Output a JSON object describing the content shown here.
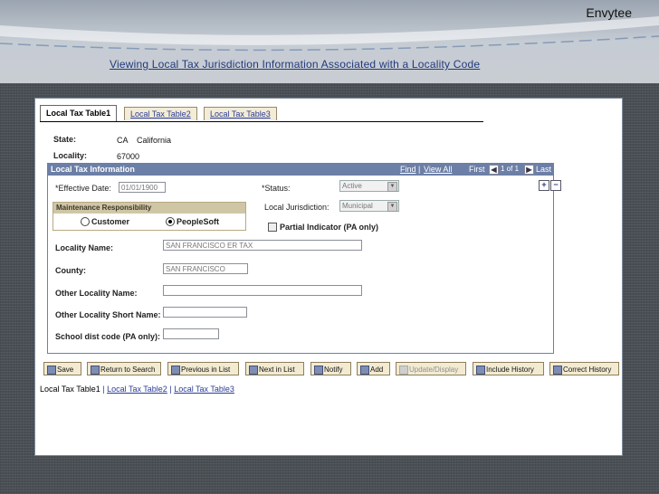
{
  "slide": {
    "brand": "Envytee",
    "title": "Viewing Local Tax Jurisdiction Information Associated with a Locality Code"
  },
  "tabs": [
    "Local Tax Table1",
    "Local Tax Table2",
    "Local Tax Table3"
  ],
  "header": {
    "state_label": "State:",
    "state_code": "CA",
    "state_name": "California",
    "locality_label": "Locality:",
    "locality_value": "67000"
  },
  "section": {
    "title": "Local Tax Information",
    "find": "Find",
    "view_all": "View All",
    "first": "First",
    "page": "1 of 1",
    "last": "Last"
  },
  "form": {
    "effective_date_label": "*Effective Date:",
    "effective_date_value": "01/01/1900",
    "status_label": "*Status:",
    "status_value": "Active",
    "local_jurisdiction_label": "Local Jurisdiction:",
    "local_jurisdiction_value": "Municipal",
    "maintenance_title": "Maintenance Responsibility",
    "radio_customer": "Customer",
    "radio_peoplesoft": "PeopleSoft",
    "partial_indicator": "Partial Indicator (PA only)",
    "locality_name_label": "Locality Name:",
    "locality_name_value": "SAN FRANCISCO ER TAX",
    "county_label": "County:",
    "county_value": "SAN FRANCISCO",
    "other_locality_name_label": "Other Locality Name:",
    "other_locality_name_value": "",
    "other_locality_short_label": "Other Locality Short Name:",
    "other_locality_short_value": "",
    "school_dist_label": "School dist code (PA only):",
    "school_dist_value": ""
  },
  "toolbar": {
    "save": "Save",
    "return": "Return to Search",
    "previous": "Previous in List",
    "next": "Next in List",
    "notify": "Notify",
    "add": "Add",
    "update": "Update/Display",
    "include_history": "Include History",
    "correct_history": "Correct History"
  },
  "footer": {
    "link1": "Local Tax Table1",
    "sep": "|",
    "link2": "Local Tax Table2",
    "link3": "Local Tax Table3"
  }
}
